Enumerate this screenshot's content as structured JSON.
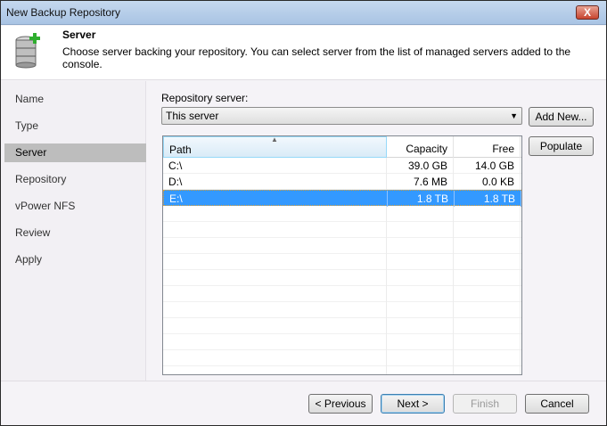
{
  "window": {
    "title": "New Backup Repository",
    "close_label": "X"
  },
  "header": {
    "title": "Server",
    "description": "Choose server backing your repository. You can select server from the list of managed servers added to the console."
  },
  "sidebar": {
    "items": [
      {
        "label": "Name"
      },
      {
        "label": "Type"
      },
      {
        "label": "Server",
        "selected": true
      },
      {
        "label": "Repository"
      },
      {
        "label": "vPower NFS"
      },
      {
        "label": "Review"
      },
      {
        "label": "Apply"
      }
    ]
  },
  "main": {
    "repo_label": "Repository server:",
    "repo_value": "This server",
    "add_new": "Add New...",
    "populate": "Populate",
    "columns": [
      "Path",
      "Capacity",
      "Free"
    ],
    "rows": [
      [
        "C:\\",
        "39.0 GB",
        "14.0 GB"
      ],
      [
        "D:\\",
        "7.6 MB",
        "0.0 KB"
      ],
      [
        "E:\\",
        "1.8 TB",
        "1.8 TB"
      ]
    ],
    "selected_row": 2
  },
  "footer": {
    "previous": "< Previous",
    "next": "Next >",
    "finish": "Finish",
    "cancel": "Cancel"
  }
}
